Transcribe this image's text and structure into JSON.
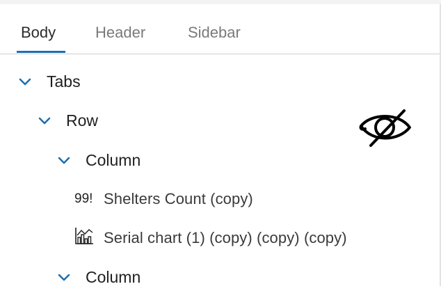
{
  "tabs": [
    {
      "label": "Body",
      "active": true
    },
    {
      "label": "Header",
      "active": false
    },
    {
      "label": "Sidebar",
      "active": false
    }
  ],
  "tree": {
    "tabs_label": "Tabs",
    "row_label": "Row",
    "column1_label": "Column",
    "widget1": {
      "icon_text": "99!",
      "label": "Shelters Count (copy)"
    },
    "widget2": {
      "icon": "bar-chart-icon",
      "label": "Serial chart (1) (copy) (copy) (copy)"
    },
    "column2_label": "Column"
  },
  "colors": {
    "accent": "#1f6fb0",
    "chevron": "#1f6fb0"
  }
}
